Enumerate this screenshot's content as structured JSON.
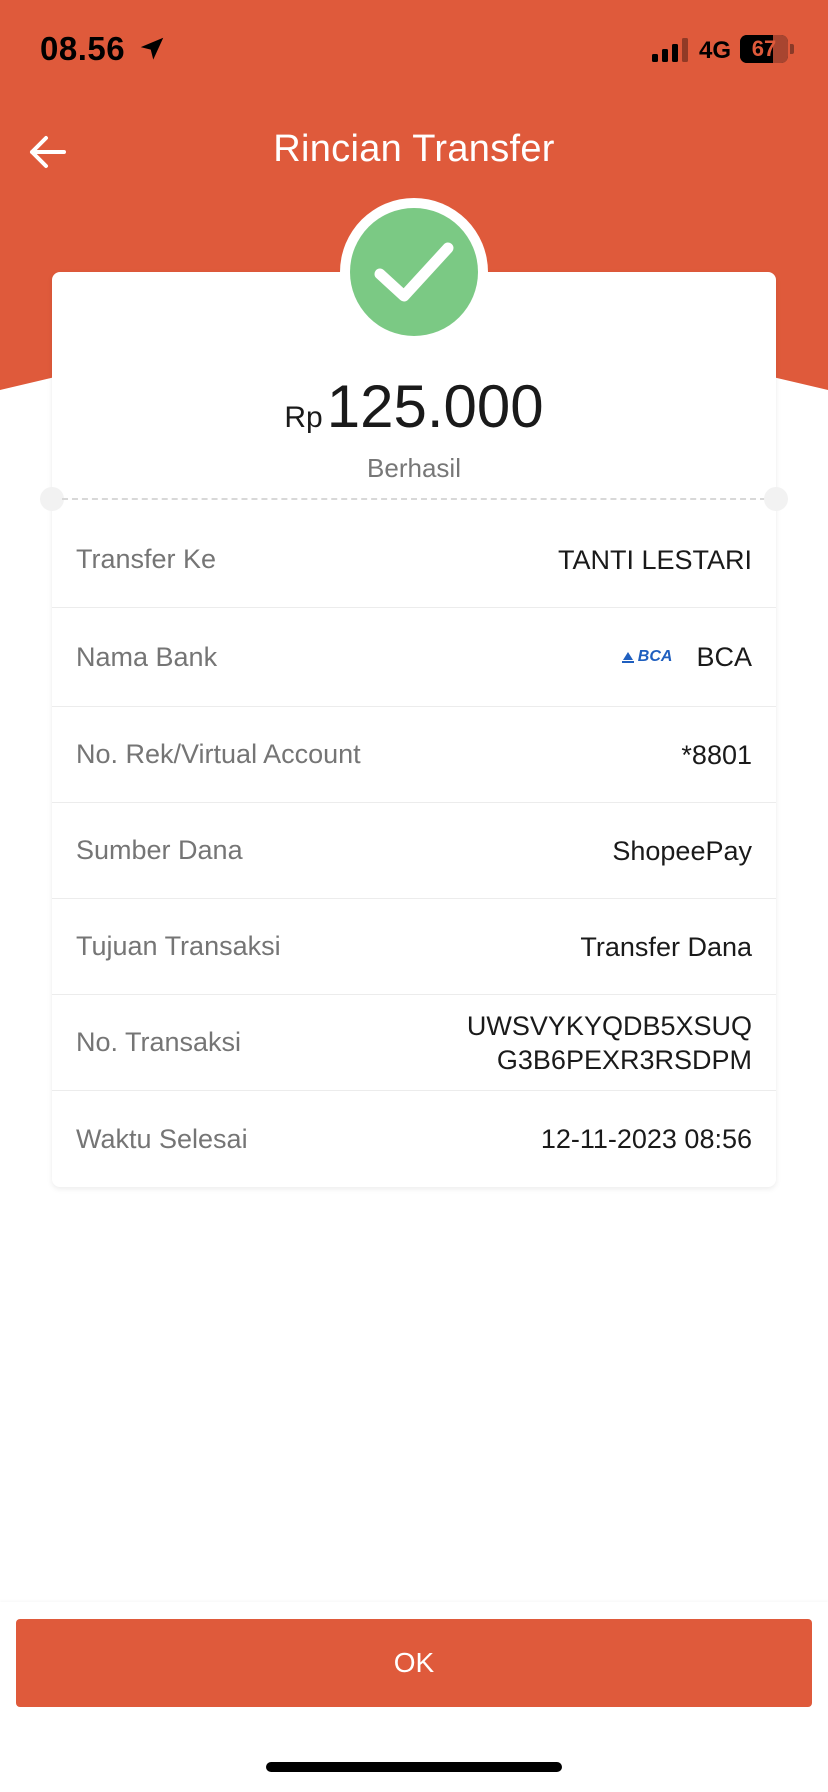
{
  "status_bar": {
    "time": "08.56",
    "network": "4G",
    "battery": "67"
  },
  "header": {
    "title": "Rincian Transfer"
  },
  "summary": {
    "currency": "Rp",
    "amount": "125.000",
    "status": "Berhasil"
  },
  "details": {
    "transfer_to": {
      "label": "Transfer Ke",
      "value": "TANTI LESTARI"
    },
    "bank": {
      "label": "Nama Bank",
      "logo_text": "BCA",
      "value": "BCA"
    },
    "account": {
      "label": "No. Rek/Virtual Account",
      "value": "*8801"
    },
    "source": {
      "label": "Sumber Dana",
      "value": "ShopeePay"
    },
    "purpose": {
      "label": "Tujuan Transaksi",
      "value": "Transfer Dana"
    },
    "transaction_no": {
      "label": "No. Transaksi",
      "value_line1": "UWSVYKYQDB5XSUQ",
      "value_line2": "G3B6PEXR3RSDPM"
    },
    "completed_time": {
      "label": "Waktu Selesai",
      "value": "12-11-2023 08:56"
    }
  },
  "footer": {
    "ok_label": "OK"
  },
  "colors": {
    "brand": "#df5a3b",
    "success": "#7bc984",
    "bca_blue": "#1f5fbf"
  },
  "icons": {
    "back": "arrow-left-icon",
    "success": "check-icon",
    "location": "location-arrow-icon",
    "signal": "signal-bars-icon",
    "battery": "battery-icon"
  }
}
